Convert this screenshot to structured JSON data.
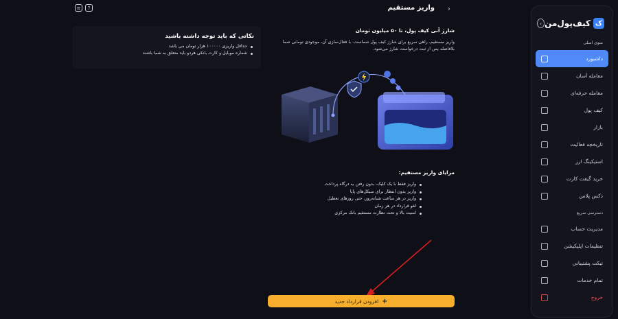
{
  "brand": {
    "name": "کیف‌پول‌من",
    "logo_letter": "ک"
  },
  "header": {
    "title": "واریز مستقیم"
  },
  "sidebar": {
    "section1_title": "منوی اصلی",
    "section2_title": "دسترسی سریع",
    "items": [
      {
        "label": "داشبورد",
        "icon": "grid-icon"
      },
      {
        "label": "معامله آسان",
        "icon": "swap-icon"
      },
      {
        "label": "معامله حرفه‌ای",
        "icon": "chart-icon"
      },
      {
        "label": "کیف پول",
        "icon": "wallet-icon"
      },
      {
        "label": "بازار",
        "icon": "market-icon"
      },
      {
        "label": "تاریخچه فعالیت",
        "icon": "calendar-icon"
      },
      {
        "label": "استیکینگ ارز",
        "icon": "staking-icon"
      },
      {
        "label": "خرید گیفت کارت",
        "icon": "gift-icon"
      },
      {
        "label": "دکس پلاس",
        "icon": "dex-icon"
      }
    ],
    "quick_items": [
      {
        "label": "مدیریت حساب",
        "icon": "account-icon"
      },
      {
        "label": "تنظیمات اپلیکیشن",
        "icon": "settings-icon"
      },
      {
        "label": "تیکت پشتیبانی",
        "icon": "ticket-icon"
      },
      {
        "label": "تمام خدمات",
        "icon": "services-icon"
      }
    ],
    "exit_label": "خروج"
  },
  "notes": {
    "title": "نکاتی که باید توجه داشته باشید",
    "items": [
      "حداقل واریزی ۱۰۰۰۰۰ هزار تومان می باشد",
      "شماره موبایل و کارت بانکی هردو باید متعلق به شما باشند"
    ]
  },
  "intro": {
    "title": "شارژ آنی کیف پول، تا ۵۰ میلیون تومان",
    "text": "واریز مستقیم، راهی سریع برای شارژ کیف پول شماست. با فعال‌سازی آن، موجودی تومانی شما بلافاصله پس از ثبت درخواست شارژ می‌شود."
  },
  "advantages": {
    "title": "مزایای واریز مستقیم:",
    "items": [
      "واریز فقط با یک کلیک، بدون رفتن به درگاه پرداخت",
      "واریز بدون انتظار برای سیکل‌های پایا",
      "واریز در هر ساعت شبانه‌روز، حتی روزهای تعطیل",
      "لغو قرارداد در هر زمان",
      "امنیت بالا و تحت نظارت مستقیم بانک مرکزی"
    ]
  },
  "cta": {
    "label": "افزودن قرارداد جدید"
  },
  "colors": {
    "accent": "#4f8af7",
    "cta": "#f7ae2c",
    "danger": "#f25252",
    "arrow": "#d61f1f"
  }
}
